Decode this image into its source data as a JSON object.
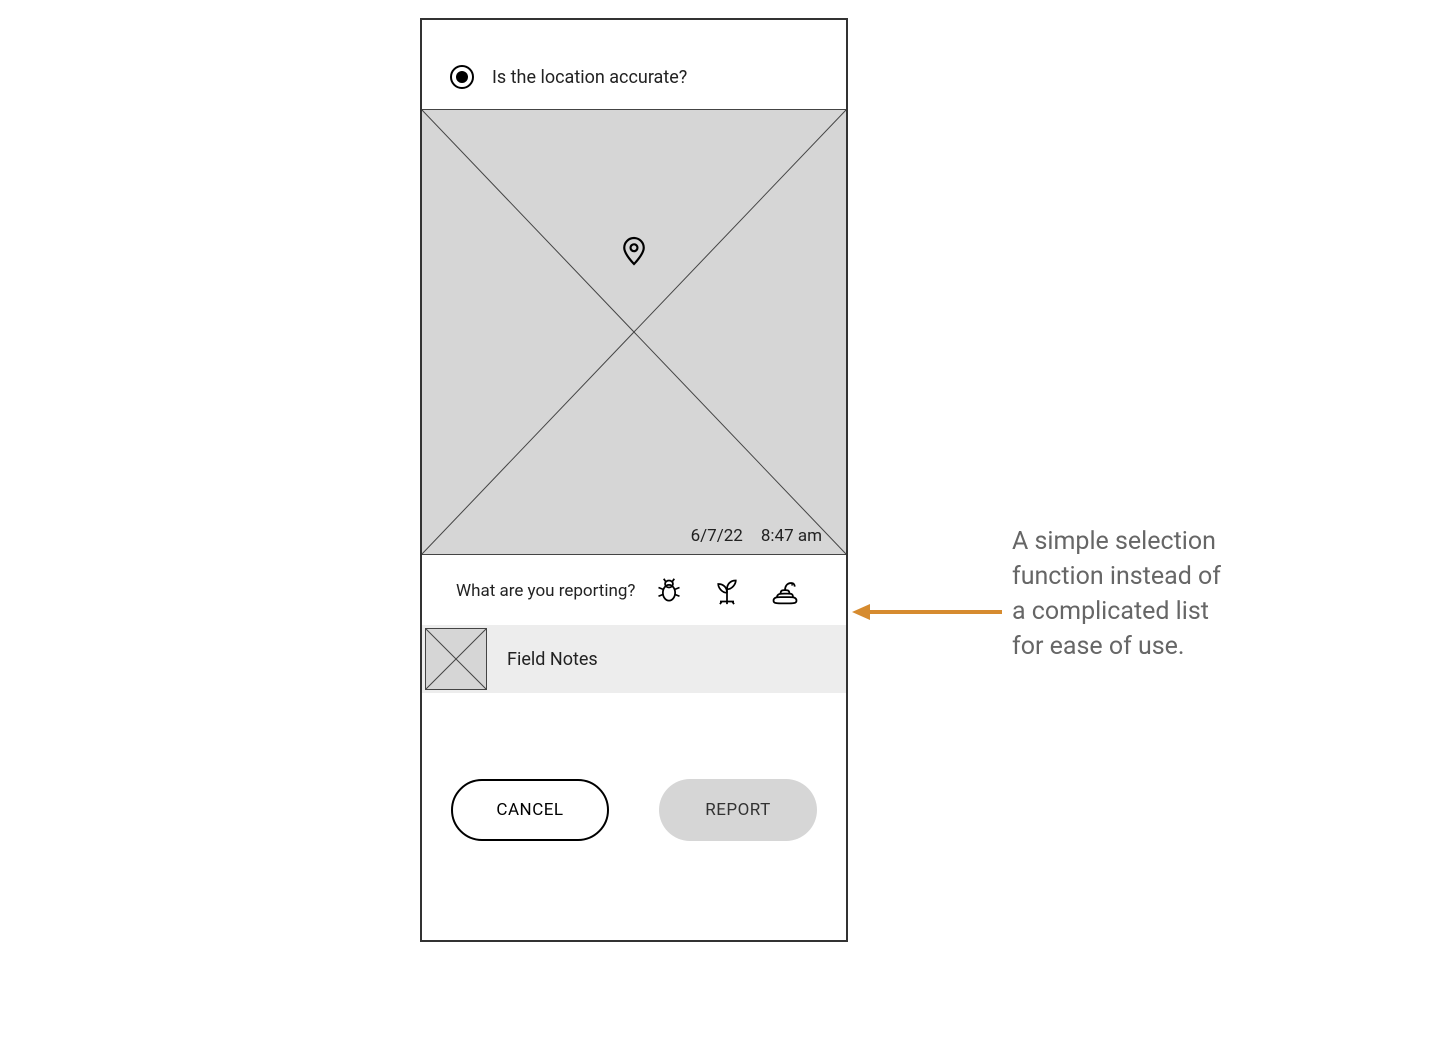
{
  "header": {
    "question": "Is the location accurate?"
  },
  "map": {
    "date": "6/7/22",
    "time": "8:47 am"
  },
  "reporting": {
    "label": "What are you reporting?"
  },
  "fieldNotes": {
    "label": "Field Notes"
  },
  "buttons": {
    "cancel": "CANCEL",
    "report": "REPORT"
  },
  "annotation": {
    "text": "A simple selection function instead of a complicated list for ease of use.",
    "arrowColor": "#d68b2f"
  }
}
